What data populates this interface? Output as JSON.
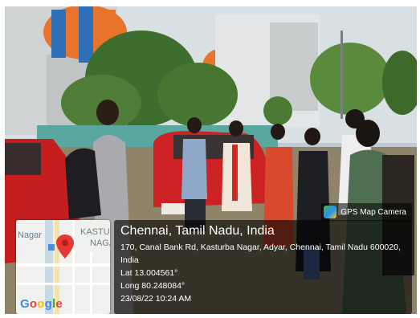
{
  "overlay": {
    "app_badge": {
      "label": "GPS Map Camera",
      "icon": "gps-map-camera-icon"
    },
    "map": {
      "labels": [
        "Nagar",
        "KASTUR",
        "NAGA"
      ],
      "logo": "Google",
      "pin_icon": "location-pin-icon",
      "logo_colors": [
        "#4285F4",
        "#EA4335",
        "#FBBC05",
        "#4285F4",
        "#34A853",
        "#EA4335"
      ]
    },
    "location": {
      "title": "Chennai, Tamil Nadu, India",
      "address": "170, Canal Bank Rd, Kasturba Nagar, Adyar, Chennai, Tamil Nadu 600020, India",
      "lat": "Lat 13.004561°",
      "long": "Long 80.248084°",
      "datetime": "23/08/22 10:24 AM"
    }
  }
}
